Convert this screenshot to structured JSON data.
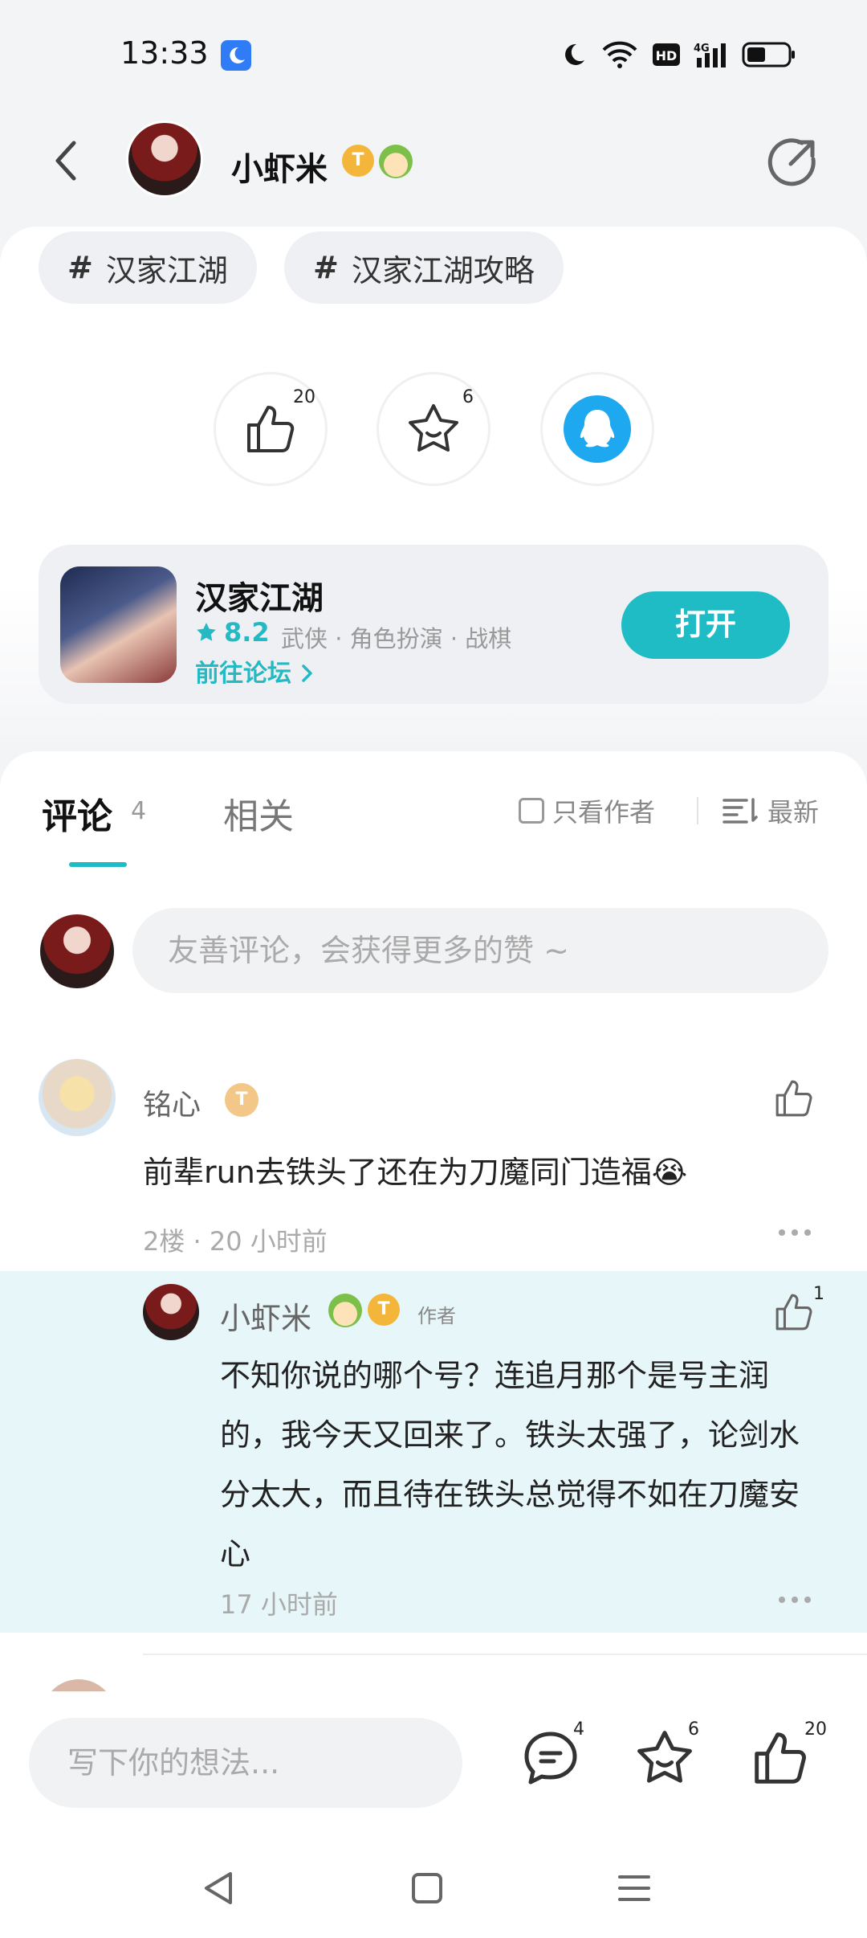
{
  "status_bar": {
    "time": "13:33"
  },
  "header": {
    "username": "小虾米",
    "badge_t": "T"
  },
  "tags": [
    "汉家江湖",
    "汉家江湖攻略"
  ],
  "tag_hash": "#",
  "actions": {
    "like_count": "20",
    "favorite_count": "6"
  },
  "game": {
    "name": "汉家江湖",
    "rating": "8.2",
    "genres": "武侠 · 角色扮演 · 战棋",
    "forum_link": "前往论坛",
    "open_button": "打开"
  },
  "comments_section": {
    "tab_comments": "评论",
    "comment_count": "4",
    "tab_related": "相关",
    "author_only": "只看作者",
    "sort": "最新",
    "input_placeholder": "友善评论，会获得更多的赞 ~"
  },
  "comment1": {
    "author": "铭心",
    "badge": "T",
    "text": "前辈run去铁头了还在为刀魔同门造福😭",
    "meta": "2楼 · 20 小时前"
  },
  "reply1": {
    "author": "小虾米",
    "badge": "T",
    "author_tag": "作者",
    "like_count": "1",
    "text": "不知你说的哪个号？连追月那个是号主润的，我今天又回来了。铁头太强了，论剑水分太大，而且待在铁头总觉得不如在刀魔安心",
    "meta": "17 小时前"
  },
  "bottom_bar": {
    "input_placeholder": "写下你的想法...",
    "comment_count": "4",
    "favorite_count": "6",
    "like_count": "20"
  },
  "colors": {
    "accent": "#20bcc6",
    "reply_bg": "#e7f6f8"
  }
}
